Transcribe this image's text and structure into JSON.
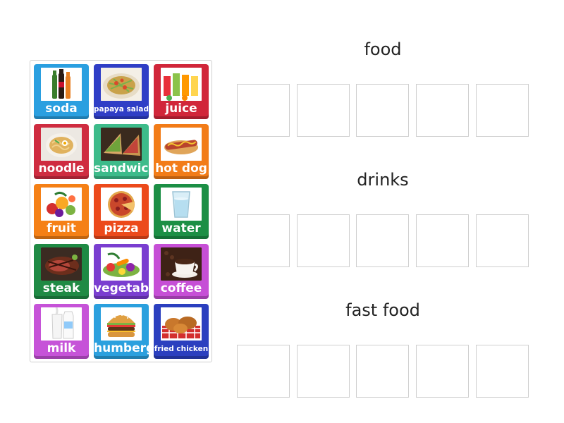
{
  "categories": [
    {
      "title": "food",
      "slot_count": 5
    },
    {
      "title": "drinks",
      "slot_count": 5
    },
    {
      "title": "fast food",
      "slot_count": 5
    }
  ],
  "cards": [
    {
      "label": "soda",
      "color": "#2a9fe0",
      "icon": "soda-bottles-icon"
    },
    {
      "label": "papaya salad",
      "color": "#2f3ec6",
      "icon": "papaya-salad-icon"
    },
    {
      "label": "juice",
      "color": "#d1263a",
      "icon": "juice-glasses-icon"
    },
    {
      "label": "noodle",
      "color": "#cf2c40",
      "icon": "noodle-bowl-icon"
    },
    {
      "label": "sandwich",
      "color": "#3dbb8a",
      "icon": "sandwich-icon"
    },
    {
      "label": "hot dog",
      "color": "#f27c18",
      "icon": "hot-dog-icon"
    },
    {
      "label": "fruit",
      "color": "#f58016",
      "icon": "fruit-icon"
    },
    {
      "label": "pizza",
      "color": "#ec4a1b",
      "icon": "pizza-icon"
    },
    {
      "label": "water",
      "color": "#1c8f45",
      "icon": "water-glass-icon"
    },
    {
      "label": "steak",
      "color": "#1f8a44",
      "icon": "steak-icon"
    },
    {
      "label": "vegetable",
      "color": "#7a3ed0",
      "icon": "vegetable-icon"
    },
    {
      "label": "coffee",
      "color": "#c64fd6",
      "icon": "coffee-cup-icon"
    },
    {
      "label": "milk",
      "color": "#c653d8",
      "icon": "milk-glass-icon"
    },
    {
      "label": "humberger",
      "color": "#2ba0de",
      "icon": "hamburger-icon"
    },
    {
      "label": "fried chicken",
      "color": "#2b3fbf",
      "icon": "fried-chicken-icon"
    }
  ]
}
